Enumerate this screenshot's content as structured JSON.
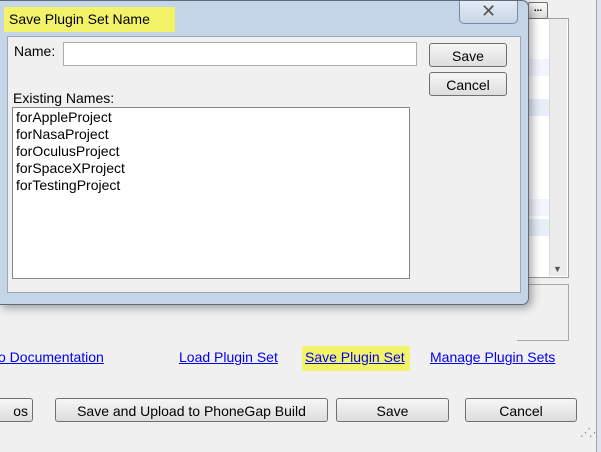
{
  "dialog": {
    "title": "Save Plugin Set Name",
    "name_label": "Name:",
    "name_value": "",
    "existing_label": "Existing Names:",
    "existing_names": [
      "forAppleProject",
      "forNasaProject",
      "forOculusProject",
      "forSpaceXProject",
      "forTestingProject"
    ],
    "save_label": "Save",
    "cancel_label": "Cancel",
    "close_glyph": "✕"
  },
  "main": {
    "ellipsis_label": "...",
    "links": {
      "help_docs": "o Documentation",
      "load_plugin_set": "Load Plugin Set",
      "save_plugin_set": "Save Plugin Set",
      "manage_plugin_sets": "Manage Plugin Sets"
    },
    "buttons": {
      "left_partial": "os",
      "save_upload": "Save and Upload to PhoneGap Build",
      "save": "Save",
      "cancel": "Cancel"
    }
  },
  "colors": {
    "highlight": "#f3f36a",
    "link": "#0000ee",
    "dialog_frame": "#c4d5e8"
  }
}
